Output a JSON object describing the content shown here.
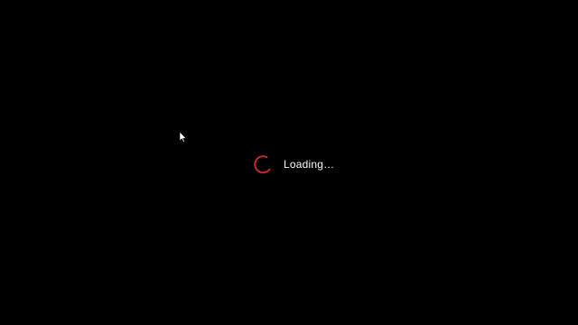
{
  "loading": {
    "label": "Loading…",
    "spinner_icon": "spinner-icon",
    "spinner_color": "#c62828"
  },
  "cursor_icon": "mouse-pointer-icon",
  "background_color": "#000000"
}
